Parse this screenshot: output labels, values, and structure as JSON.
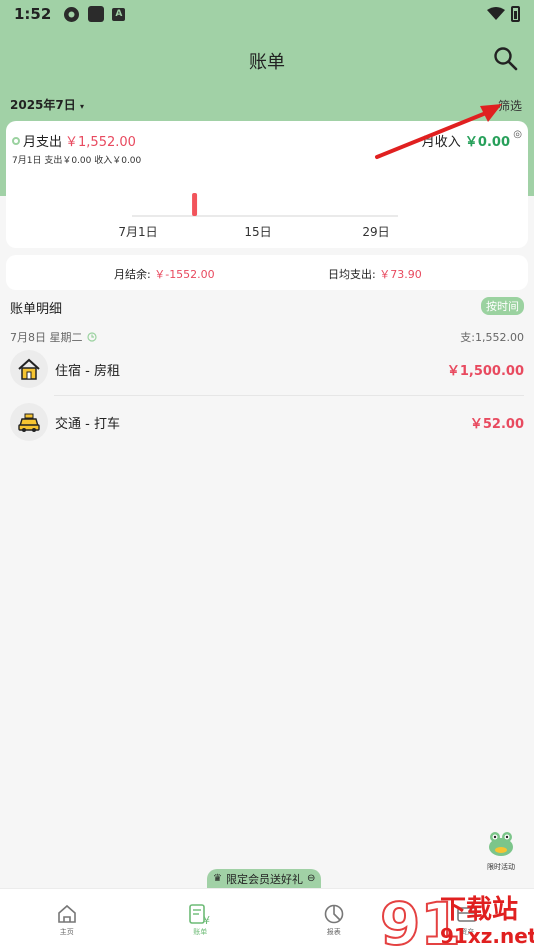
{
  "status": {
    "time": "1:52"
  },
  "header": {
    "title": "账单",
    "month": "2025年7日",
    "filter": "筛选"
  },
  "summary": {
    "expense_label": "月支出",
    "expense_value": "￥1,552.00",
    "income_label": "月收入",
    "income_value": "￥0.00",
    "daily_line": "7月1日 支出￥0.00 收入￥0.00"
  },
  "chart_data": {
    "type": "bar",
    "x": [
      1,
      8,
      15,
      29
    ],
    "values": [
      0,
      1552,
      0,
      0
    ],
    "tick_labels": [
      "7月1日",
      "15日",
      "29日"
    ],
    "color": "#f2545b"
  },
  "balance": {
    "label": "月结余:",
    "value": "￥-1552.00",
    "avg_label": "日均支出:",
    "avg_value": "￥73.90"
  },
  "details": {
    "title": "账单明细",
    "sort_label": "按时间",
    "groups": [
      {
        "date": "7月8日 星期二",
        "total": "支:1,552.00",
        "items": [
          {
            "name": "住宿 - 房租",
            "amount": "￥1,500.00",
            "icon": "house-icon"
          },
          {
            "name": "交通 - 打车",
            "amount": "￥52.00",
            "icon": "taxi-icon"
          }
        ]
      }
    ]
  },
  "promo": {
    "label": "限定会员送好礼",
    "activity": "限时活动"
  },
  "tabs": [
    {
      "label": "主页",
      "icon": "home-icon"
    },
    {
      "label": "账单",
      "icon": "bill-icon",
      "active": true
    },
    {
      "label": "报表",
      "icon": "report-icon"
    },
    {
      "label": "资产",
      "icon": "assets-icon"
    }
  ],
  "watermark": {
    "big": "下载站",
    "site": "91xz.net"
  },
  "colors": {
    "header": "#a1d1a6",
    "expense": "#e84a5f",
    "income": "#27a05a",
    "arrow": "#e02020"
  }
}
